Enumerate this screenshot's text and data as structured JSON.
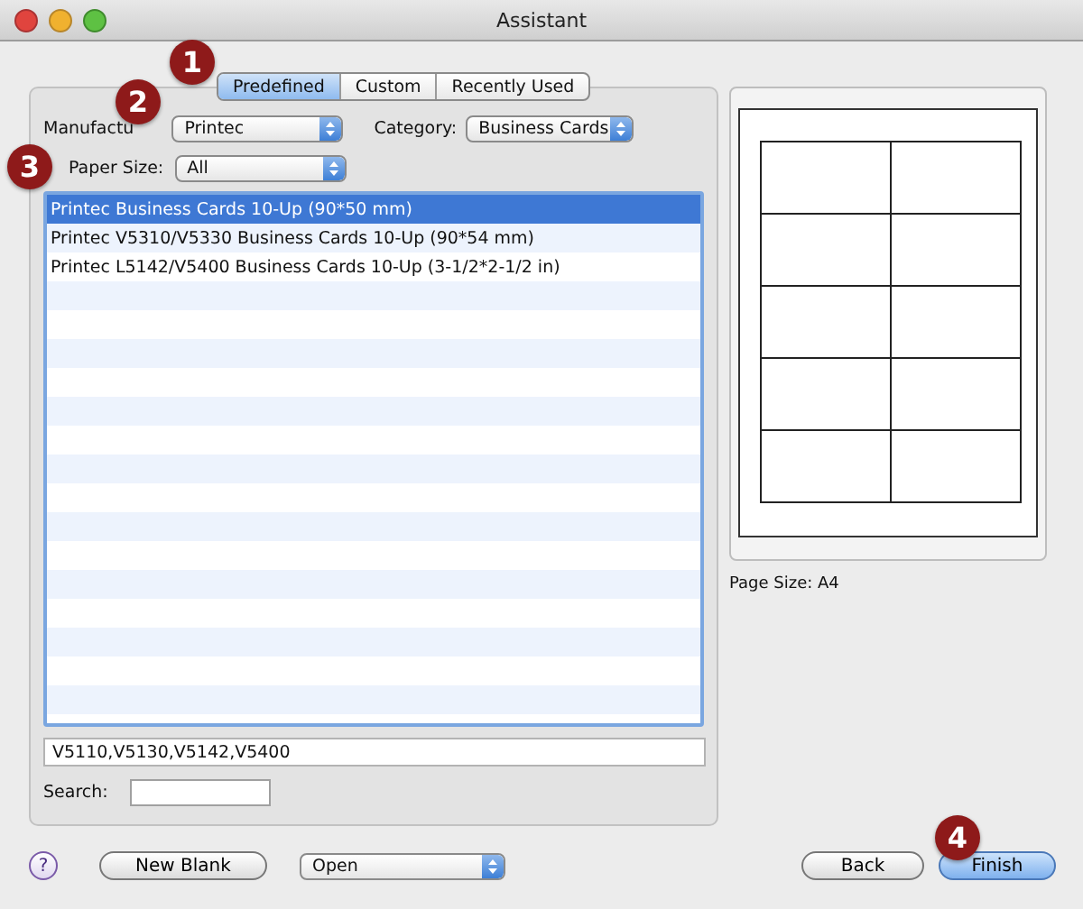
{
  "window": {
    "title": "Assistant"
  },
  "tabs": [
    {
      "label": "Predefined",
      "selected": true
    },
    {
      "label": "Custom",
      "selected": false
    },
    {
      "label": "Recently Used",
      "selected": false
    }
  ],
  "filters": {
    "manufacturer_label": "Manufactu",
    "manufacturer": "Printec",
    "category_label": "Category:",
    "category": "Business Cards",
    "paper_size_label": "Paper Size:",
    "paper_size": "All"
  },
  "templates": [
    {
      "name": "Printec Business Cards 10-Up (90*50 mm)",
      "selected": true
    },
    {
      "name": "Printec V5310/V5330 Business Cards 10-Up (90*54 mm)",
      "selected": false
    },
    {
      "name": "Printec L5142/V5400 Business Cards 10-Up (3-1/2*2-1/2 in)",
      "selected": false
    }
  ],
  "models": "V5110,V5130,V5142,V5400",
  "search": {
    "label": "Search:"
  },
  "preview": {
    "page_size": "Page Size: A4"
  },
  "footer": {
    "help": "?",
    "new_blank": "New Blank",
    "open": "Open",
    "buttons": [
      {
        "label": "Back",
        "kind": "push"
      },
      {
        "label": "Finish",
        "kind": "default"
      }
    ]
  },
  "callouts": [
    "1",
    "2",
    "3",
    "4"
  ]
}
